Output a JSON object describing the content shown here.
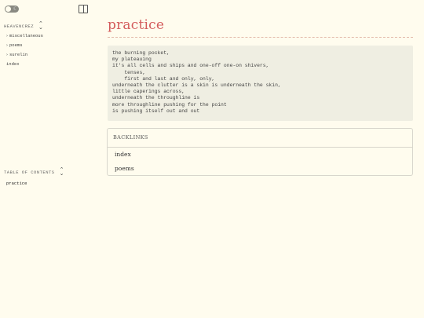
{
  "sidebar": {
    "site_title": "HEAVENCREZ",
    "items": [
      {
        "label": "miscellaneous",
        "chevron": "›"
      },
      {
        "label": "poems",
        "chevron": "›"
      },
      {
        "label": "surelin",
        "chevron": "›"
      },
      {
        "label": "index",
        "chevron": ""
      }
    ],
    "toc_title": "TABLE OF CONTENTS",
    "toc_items": [
      "practice"
    ]
  },
  "page": {
    "title": "practice",
    "code_lines": [
      "the burning pocket,",
      "my plateauing",
      "it's all cells and ships and one-off one-on shivers,",
      "    tenses,",
      "    first and last and only, only,",
      "underneath the clutter is a skin is underneath the skin,",
      "little caperings across,",
      "underneath the throughline is",
      "more throughline pushing for the point",
      "is pushing itself out and out"
    ],
    "backlinks": {
      "title": "BACKLINKS",
      "items": [
        "index",
        "poems"
      ]
    }
  },
  "colors": {
    "background": "#fffcee",
    "title": "#d35b5b",
    "code_bg": "#efeee2"
  }
}
